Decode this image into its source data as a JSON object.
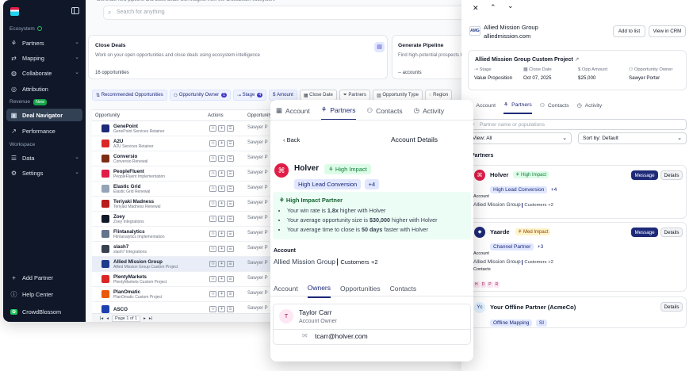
{
  "sidebar": {
    "sections": {
      "ecosystem": "Ecosystem",
      "revenue": "Revenue",
      "workspace": "Workspace"
    },
    "new_badge": "New",
    "items": [
      {
        "label": "Partners",
        "icon": "partners-icon"
      },
      {
        "label": "Mapping",
        "icon": "mapping-icon"
      },
      {
        "label": "Collaborate",
        "icon": "collaborate-icon"
      },
      {
        "label": "Attribution",
        "icon": "attribution-icon"
      },
      {
        "label": "Deal Navigator",
        "icon": "deal-navigator-icon"
      },
      {
        "label": "Performance",
        "icon": "performance-icon"
      },
      {
        "label": "Data",
        "icon": "data-icon"
      },
      {
        "label": "Settings",
        "icon": "settings-icon"
      }
    ],
    "footer": [
      {
        "label": "Add Partner"
      },
      {
        "label": "Help Center"
      },
      {
        "label": "CrowdBlossom"
      }
    ]
  },
  "header": {
    "search_placeholder": "Search for anything",
    "banner_text": "Generate new pipeline and close deals with insights from the CrossBeam ecosystem"
  },
  "cards": {
    "close_deals": {
      "title": "Close Deals",
      "desc": "Work on your open opportunities and close deals using ecosystem intelligence",
      "count": "16 opportunities"
    },
    "generate_pipeline": {
      "title": "Generate Pipeline",
      "desc": "Find high-potential prospects b",
      "count": "-- accounts"
    }
  },
  "filters": [
    {
      "label": "Recommended Opportunities",
      "count": ""
    },
    {
      "label": "Opportunity Owner",
      "count": "1"
    },
    {
      "label": "Stage",
      "count": "4"
    },
    {
      "label": "Amount",
      "count": ""
    },
    {
      "label": "Close Date",
      "count": ""
    },
    {
      "label": "Partners",
      "count": ""
    },
    {
      "label": "Opportunity Type",
      "count": ""
    },
    {
      "label": "Region",
      "count": ""
    }
  ],
  "table": {
    "columns": [
      "Opportunity",
      "Actions",
      "Opportunity"
    ],
    "rows": [
      {
        "name": "GenePoint",
        "sub": "GenePoint Services Retainer",
        "owner": "Sawyer P",
        "color": "#1e2a78"
      },
      {
        "name": "A2U",
        "sub": "A2U Services Retainer",
        "owner": "Sawyer P",
        "color": "#dc2626"
      },
      {
        "name": "Conversio",
        "sub": "Conversio Renewal",
        "owner": "Sawyer P",
        "color": "#7c2d12"
      },
      {
        "name": "PeopleFluent",
        "sub": "PeopleFluent Implementation",
        "owner": "Sawyer P",
        "color": "#e11d48"
      },
      {
        "name": "Elastic Grid",
        "sub": "Elastic Grid Renewal",
        "owner": "Sawyer P",
        "color": "#94a3b8"
      },
      {
        "name": "Teriyaki Madness",
        "sub": "Teriyaki Madness Renewal",
        "owner": "Sawyer P",
        "color": "#b91c1c"
      },
      {
        "name": "Zoey",
        "sub": "Zoey Integrations",
        "owner": "Sawyer P",
        "color": "#111827"
      },
      {
        "name": "Flintanalytics",
        "sub": "Flintanalytics Implementation",
        "owner": "Sawyer P",
        "color": "#64748b"
      },
      {
        "name": "slash7",
        "sub": "slash7 Integrations",
        "owner": "Sawyer P",
        "color": "#374151"
      },
      {
        "name": "Allied Mission Group",
        "sub": "Allied Mission Group Custom Project",
        "owner": "Sawyer P",
        "color": "#1e3a8a"
      },
      {
        "name": "PlentyMarkets",
        "sub": "PlentyMarkets Custom Project",
        "owner": "Sawyer P",
        "color": "#dc2626"
      },
      {
        "name": "PlanOmatic",
        "sub": "PlanOmatic Custom Project",
        "owner": "Sawyer P",
        "color": "#ea580c"
      },
      {
        "name": "ASCO",
        "sub": "",
        "owner": "Sawyer P",
        "color": "#1e40af"
      }
    ],
    "pager": "Page 1 of 1"
  },
  "mid": {
    "tabs": [
      "Account",
      "Partners",
      "Contacts",
      "Activity"
    ],
    "back": "Back",
    "title": "Account Details",
    "partner_name": "Holver",
    "impact": "High Impact",
    "tag": "High Lead Conversion",
    "tag_more": "+4",
    "box_title": "High Impact Partner",
    "bullets": [
      {
        "a": "Your win rate is ",
        "b": "1.8x",
        "c": " higher with Holver"
      },
      {
        "a": "Your average opportunity size is ",
        "b": "$30,000",
        "c": " higher with Holver"
      },
      {
        "a": "Your average time to close is ",
        "b": "50 days",
        "c": " faster with Holver"
      }
    ],
    "account_label": "Account",
    "account_name": "Allied Mission Group",
    "account_pop": "Customers",
    "account_more": "+2",
    "subtabs": [
      "Account",
      "Owners",
      "Opportunities",
      "Contacts"
    ],
    "owner_initial": "T",
    "owner_name": "Taylor Carr",
    "owner_role": "Account Owner",
    "owner_email": "tcarr@holver.com"
  },
  "right": {
    "company": "Allied Mission Group",
    "domain": "alliedmission.com",
    "add_list": "Add to list",
    "view_crm": "View in CRM",
    "opp_title": "Allied Mission Group Custom Project",
    "fields": [
      {
        "label": "Stage",
        "value": "Value Proposition"
      },
      {
        "label": "Close Date",
        "value": "Oct 07, 2025"
      },
      {
        "label": "Opp Amount",
        "value": "$25,000"
      },
      {
        "label": "Opportunity Owner",
        "value": "Sawyer Porter"
      }
    ],
    "tabs": [
      "Account",
      "Partners",
      "Contacts",
      "Activity"
    ],
    "search_placeholder": "Partner name or populations",
    "view_select": "View: All",
    "sort_select": "Sort by: Default",
    "section": "Partners",
    "message": "Message",
    "details": "Details",
    "account_label": "Account",
    "contacts_label": "Contacts",
    "partners": [
      {
        "name": "Holver",
        "impact": "High Impact",
        "tag": "High Lead Conversion",
        "more": "+4",
        "account": "Allied Mission Group",
        "pop": "Customers",
        "pmore": "+2"
      },
      {
        "name": "Yaarde",
        "impact": "Med Impact",
        "tag": "Channel Partner",
        "more": "+3",
        "account": "Allied Mission Group",
        "pop": "Customers",
        "pmore": "+2",
        "contacts": [
          "H",
          "D",
          "P",
          "R"
        ]
      },
      {
        "name": "Your Offline Partner (AcmeCo)",
        "tag": "Offline Mapping",
        "more": "SI"
      }
    ]
  }
}
